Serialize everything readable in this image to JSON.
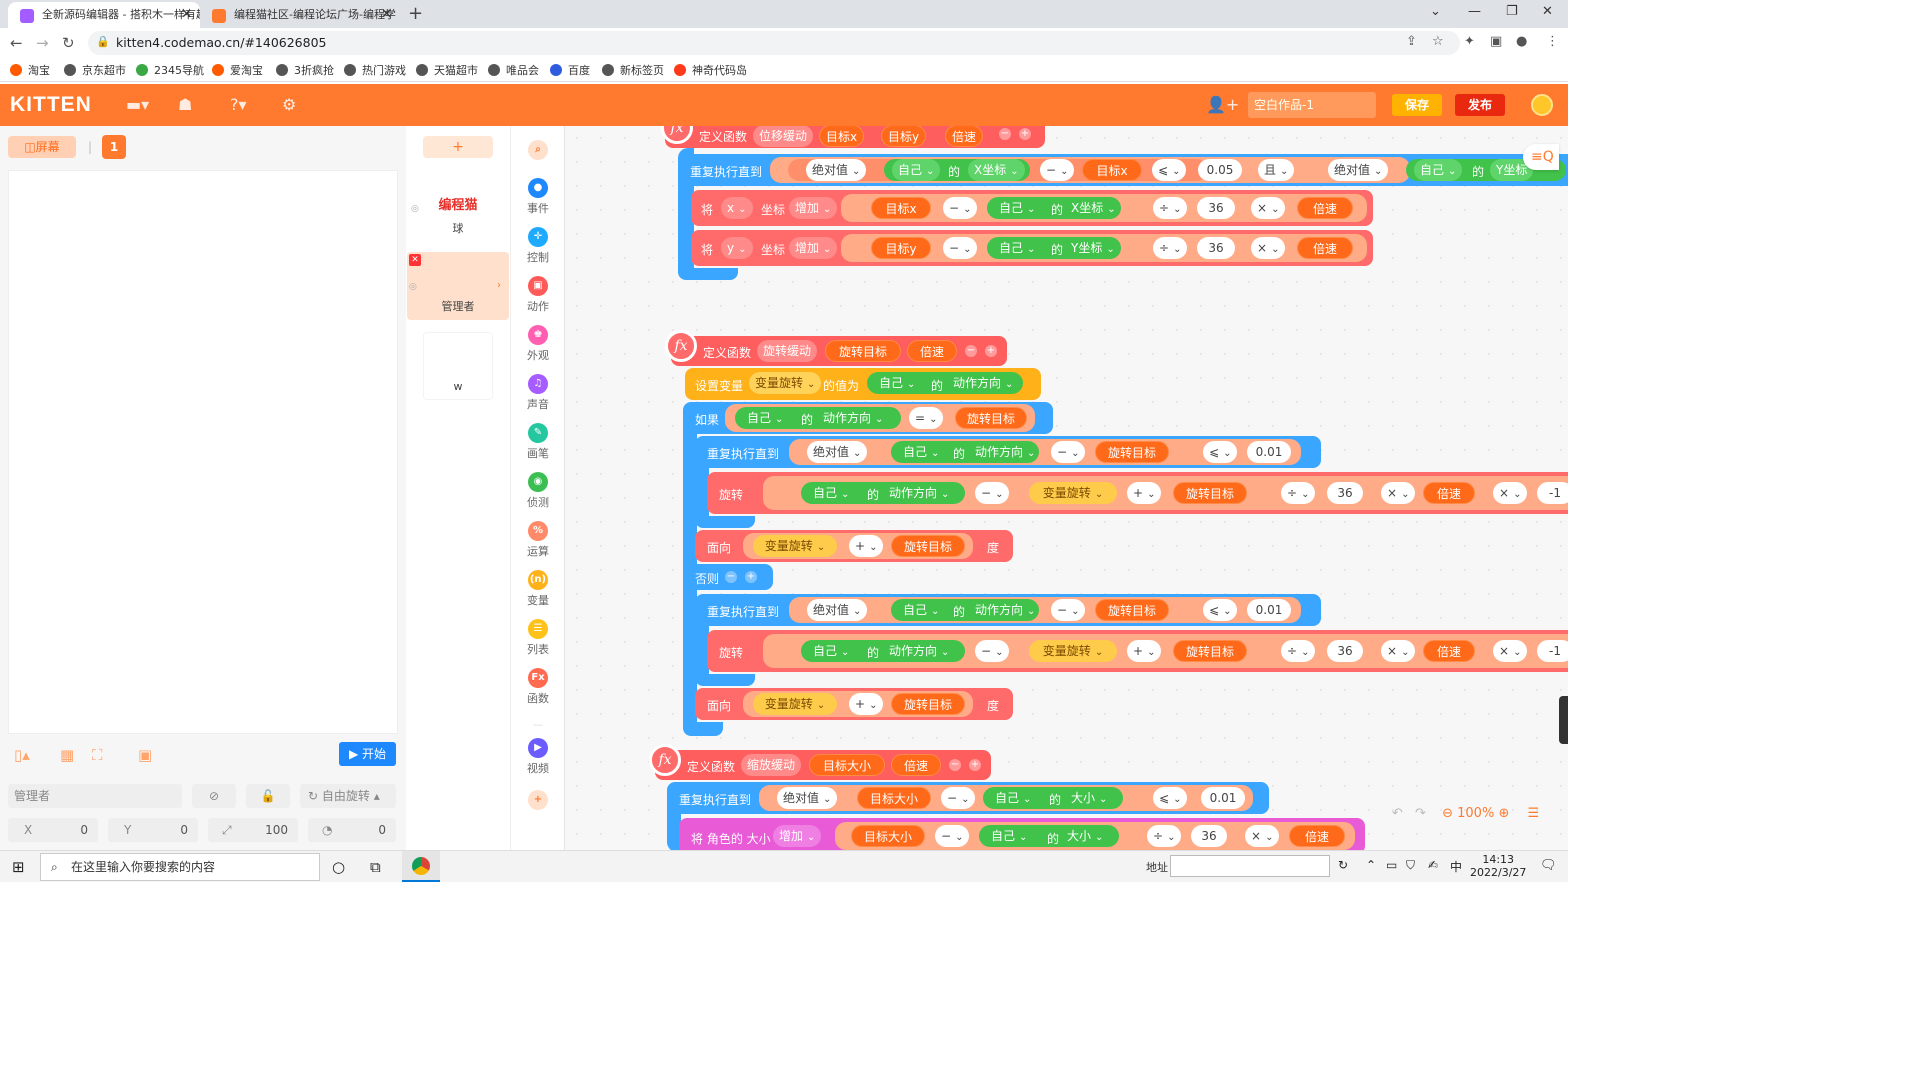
{
  "browser": {
    "tabs": [
      {
        "title": "全新源码编辑器 - 搭积木一样有趣"
      },
      {
        "title": "编程猫社区-编程论坛广场-编程学"
      }
    ],
    "url": "kitten4.codemao.cn/#140626805",
    "bookmarks": [
      "淘宝",
      "京东超市",
      "2345导航",
      "爱淘宝",
      "3折疯抢",
      "热门游戏",
      "天猫超市",
      "唯品会",
      "百度",
      "新标签页",
      "神奇代码岛"
    ]
  },
  "app": {
    "logo": "KITTEN",
    "project_name": "空白作品-1",
    "save": "保存",
    "publish": "发布"
  },
  "stage": {
    "screen_btn": "屏幕",
    "page_num": "1",
    "start": "开始",
    "sprite_name": "管理者",
    "rotation_mode": "自由旋转",
    "x_label": "X",
    "x_val": "0",
    "y_label": "Y",
    "y_val": "0",
    "size_val": "100",
    "dir_val": "0"
  },
  "sprites": {
    "add": "+",
    "items": [
      {
        "thumb_text": "编程猫",
        "label": "球"
      },
      {
        "thumb_text": "",
        "label": "管理者"
      },
      {
        "thumb_text": "",
        "label": "w"
      }
    ]
  },
  "categories": [
    {
      "label": "事件",
      "color": "#1e88ff"
    },
    {
      "label": "控制",
      "color": "#1eaaff"
    },
    {
      "label": "动作",
      "color": "#ff5a5a"
    },
    {
      "label": "外观",
      "color": "#ff5fb0"
    },
    {
      "label": "声音",
      "color": "#a65cff"
    },
    {
      "label": "画笔",
      "color": "#24c7a0"
    },
    {
      "label": "侦测",
      "color": "#3cbf52"
    },
    {
      "label": "运算",
      "color": "#ff8a6a"
    },
    {
      "label": "变量",
      "color": "#ffb11a"
    },
    {
      "label": "列表",
      "color": "#ffc21a"
    },
    {
      "label": "函数",
      "color": "#ff6a50"
    },
    {
      "label": "视频",
      "color": "#6a5cff"
    }
  ],
  "zoom": "100%",
  "blocks": {
    "def": "定义函数",
    "f1": {
      "name": "位移缓动",
      "p1": "目标x",
      "p2": "目标y",
      "p3": "倍速"
    },
    "repeat_until": "重复执行直到",
    "abs": "绝对值",
    "self": "自己",
    "of": "的",
    "xcoord": "X坐标",
    "ycoord": "Y坐标",
    "minus": "−",
    "le": "⩽",
    "and": "且",
    "n005": "0.05",
    "set_coord_x": "将",
    "x": "x",
    "y": "y",
    "coord": "坐标",
    "increase": "增加",
    "div": "÷",
    "mul": "×",
    "n36": "36",
    "f2": {
      "name": "旋转缓动",
      "p1": "旋转目标",
      "p2": "倍速"
    },
    "set_var": "设置变量",
    "var_rot": "变量旋转",
    "value_is": "的值为",
    "dir": "动作方向",
    "if": "如果",
    "eq": "=",
    "n001": "0.01",
    "rotate": "旋转",
    "plus": "+",
    "neg1": "-1",
    "face": "面向",
    "deg": "度",
    "else": "否则",
    "f3": {
      "name": "缩放缓动",
      "p1": "目标大小",
      "p2": "倍速"
    },
    "size": "大小",
    "set_size": "将 角色的 大小"
  },
  "taskbar": {
    "search": "在这里输入你要搜索的内容",
    "addr_label": "地址",
    "time": "14:13",
    "date": "2022/3/27",
    "ime": "中"
  }
}
